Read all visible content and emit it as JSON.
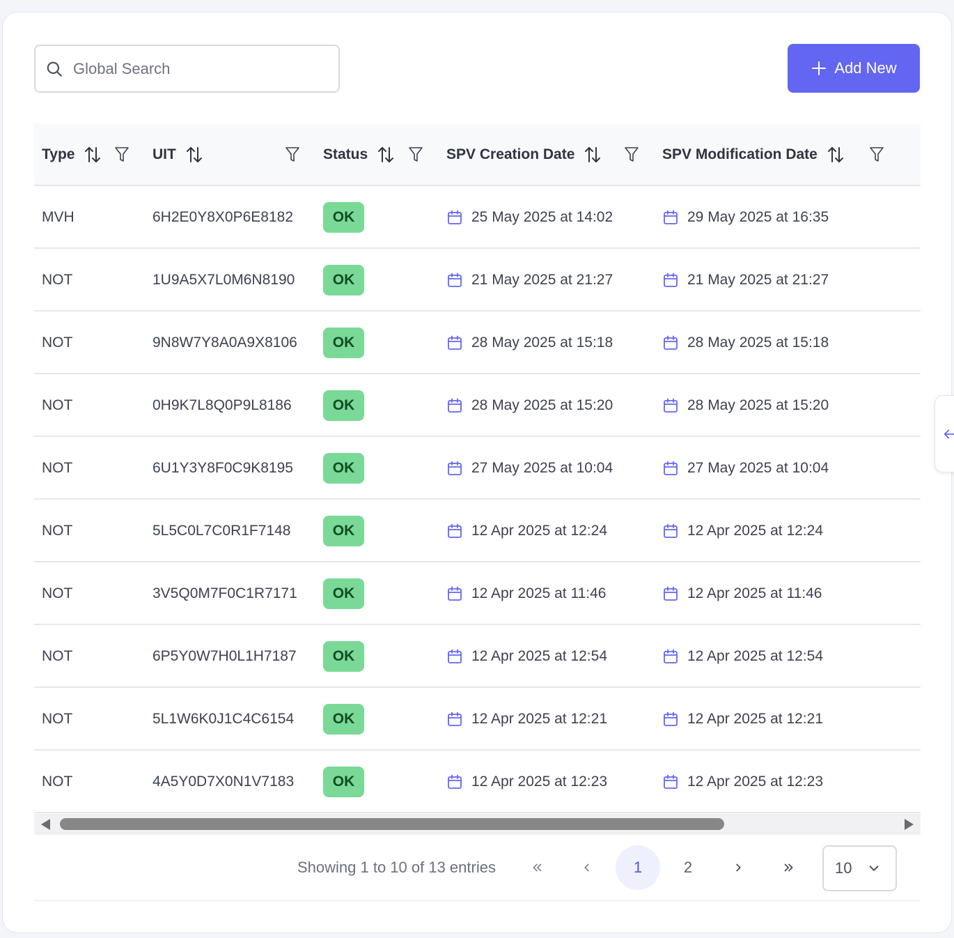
{
  "search": {
    "placeholder": "Global Search",
    "icon": "search-icon"
  },
  "add_button": {
    "label": "Add New",
    "icon": "plus-icon",
    "color": "#6366f1"
  },
  "table": {
    "columns": [
      {
        "label": "Type",
        "sortable": true,
        "filterable": true
      },
      {
        "label": "UIT",
        "sortable": true,
        "filterable": true
      },
      {
        "label": "Status",
        "sortable": true,
        "filterable": true
      },
      {
        "label": "SPV Creation Date",
        "sortable": true,
        "filterable": true
      },
      {
        "label": "SPV Modification Date",
        "sortable": true,
        "filterable": true
      }
    ],
    "rows": [
      {
        "type": "MVH",
        "uit": "6H2E0Y8X0P6E8182",
        "status": "OK",
        "created": "25 May 2025 at 14:02",
        "modified": "29 May 2025 at 16:35"
      },
      {
        "type": "NOT",
        "uit": "1U9A5X7L0M6N8190",
        "status": "OK",
        "created": "21 May 2025 at 21:27",
        "modified": "21 May 2025 at 21:27"
      },
      {
        "type": "NOT",
        "uit": "9N8W7Y8A0A9X8106",
        "status": "OK",
        "created": "28 May 2025 at 15:18",
        "modified": "28 May 2025 at 15:18"
      },
      {
        "type": "NOT",
        "uit": "0H9K7L8Q0P9L8186",
        "status": "OK",
        "created": "28 May 2025 at 15:20",
        "modified": "28 May 2025 at 15:20"
      },
      {
        "type": "NOT",
        "uit": "6U1Y3Y8F0C9K8195",
        "status": "OK",
        "created": "27 May 2025 at 10:04",
        "modified": "27 May 2025 at 10:04"
      },
      {
        "type": "NOT",
        "uit": "5L5C0L7C0R1F7148",
        "status": "OK",
        "created": "12 Apr 2025 at 12:24",
        "modified": "12 Apr 2025 at 12:24"
      },
      {
        "type": "NOT",
        "uit": "3V5Q0M7F0C1R7171",
        "status": "OK",
        "created": "12 Apr 2025 at 11:46",
        "modified": "12 Apr 2025 at 11:46"
      },
      {
        "type": "NOT",
        "uit": "6P5Y0W7H0L1H7187",
        "status": "OK",
        "created": "12 Apr 2025 at 12:54",
        "modified": "12 Apr 2025 at 12:54"
      },
      {
        "type": "NOT",
        "uit": "5L1W6K0J1C4C6154",
        "status": "OK",
        "created": "12 Apr 2025 at 12:21",
        "modified": "12 Apr 2025 at 12:21"
      },
      {
        "type": "NOT",
        "uit": "4A5Y0D7X0N1V7183",
        "status": "OK",
        "created": "12 Apr 2025 at 12:23",
        "modified": "12 Apr 2025 at 12:23"
      }
    ],
    "status_color": "#7ad996"
  },
  "pagination": {
    "info": "Showing 1 to 10 of 13 entries",
    "pages": [
      "1",
      "2"
    ],
    "current_page": "1",
    "page_size": "10"
  }
}
